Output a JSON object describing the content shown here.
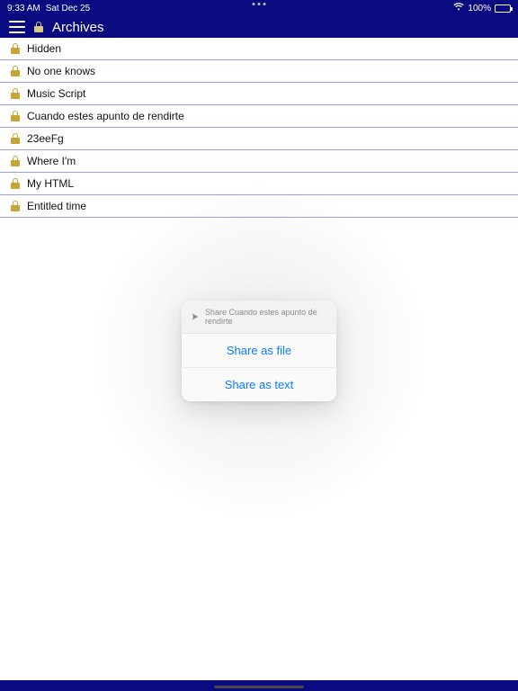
{
  "status": {
    "time": "9:33 AM",
    "date": "Sat Dec 25",
    "battery_pct": "100%",
    "wifi": true
  },
  "nav": {
    "title": "Archives"
  },
  "list": {
    "items": [
      {
        "label": "Hidden"
      },
      {
        "label": "No one knows"
      },
      {
        "label": "Music Script"
      },
      {
        "label": "Cuando estes apunto de rendirte"
      },
      {
        "label": "23eeFg"
      },
      {
        "label": "Where I'm"
      },
      {
        "label": "My HTML"
      },
      {
        "label": "Entitled time"
      }
    ]
  },
  "sheet": {
    "header": "Share Cuando estes apunto de rendirte",
    "option_file": "Share as file",
    "option_text": "Share as text"
  }
}
